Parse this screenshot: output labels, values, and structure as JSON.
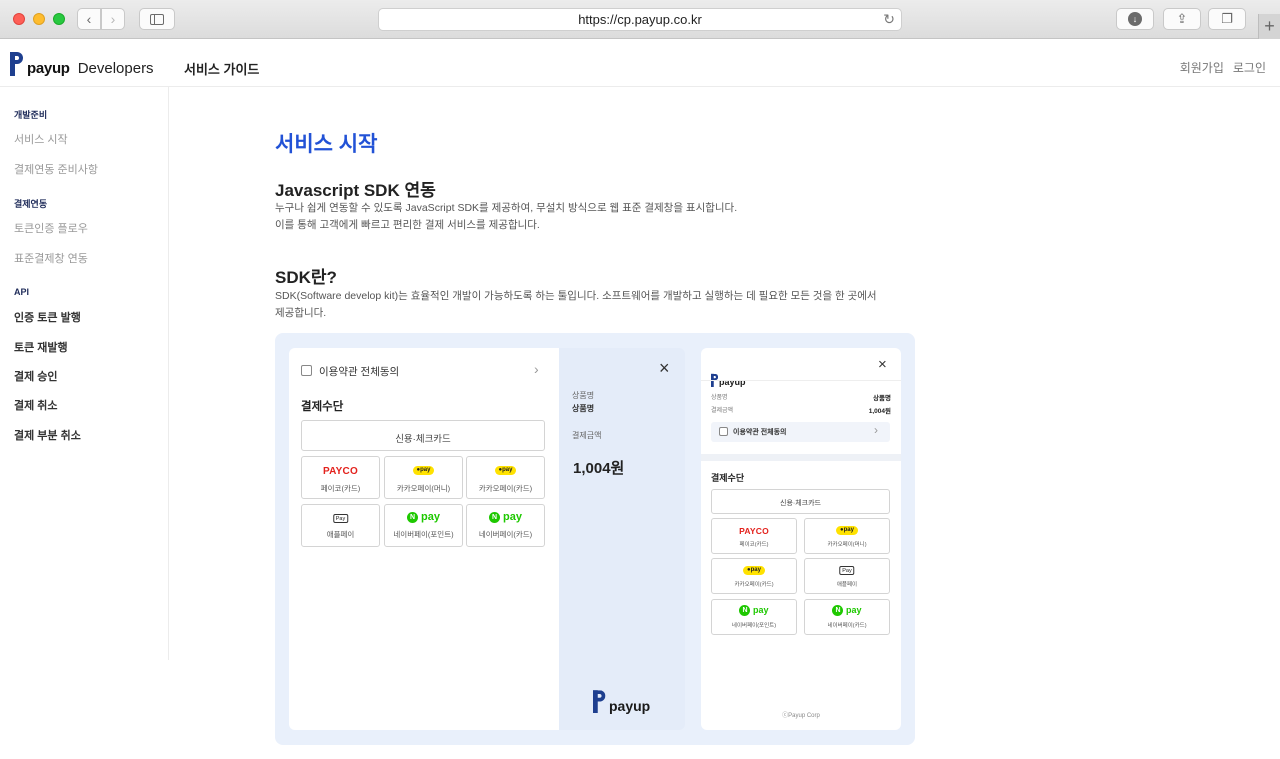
{
  "browser": {
    "url": "https://cp.payup.co.kr"
  },
  "header": {
    "brand": "payup",
    "brand_suffix": "Developers",
    "nav_item": "서비스 가이드",
    "signup": "회원가입",
    "login": "로그인"
  },
  "sidebar": {
    "sections": [
      {
        "title": "개발준비",
        "items": [
          "서비스 시작",
          "결제연동 준비사항"
        ]
      },
      {
        "title": "결제연동",
        "items": [
          "토큰인증 플로우",
          "표준결제창 연동"
        ]
      },
      {
        "title": "API",
        "items": [
          "인증 토큰 발행",
          "토큰 재발행",
          "결제 승인",
          "결제 취소",
          "결제 부분 취소"
        ]
      }
    ]
  },
  "main": {
    "title": "서비스 시작",
    "section1_heading": "Javascript SDK 연동",
    "section1_line1": "누구나 쉽게 연동할 수 있도록 JavaScript SDK를 제공하여, 무설치 방식으로 웹 표준 결제창을 표시합니다.",
    "section1_line2": "이를 통해 고객에게 빠르고 편리한 결제 서비스를 제공합니다.",
    "section2_heading": "SDK란?",
    "section2_line1": "SDK(Software develop kit)는 효율적인 개발이 가능하도록 하는 툴입니다. 소프트웨어를 개발하고 실행하는 데 필요한 모든 것을 한 곳에서",
    "section2_line2": "제공합니다."
  },
  "illustration": {
    "agree_all": "이용약관 전체동의",
    "payment_method": "결제수단",
    "card_button": "신용·체크카드",
    "payco_logo": "PAYCO",
    "payco_label": "페이코(카드)",
    "kakao_logo": "pay",
    "kakao_money_label": "카카오페이(머니)",
    "kakao_card_label": "카카오페이(카드)",
    "apple_logo": "Pay",
    "apple_label": "애플페이",
    "naver_logo": "pay",
    "naver_point_label": "네이버페이(포인트)",
    "naver_card_label": "네이버페이(카드)",
    "product_label": "상품명",
    "product_value": "상품명",
    "amount_label": "결제금액",
    "amount_value": "1,004원",
    "mobile_amount_label": "결제금액",
    "mobile_amount_value": "1,004원",
    "footer": "ⓒPayup Corp"
  }
}
